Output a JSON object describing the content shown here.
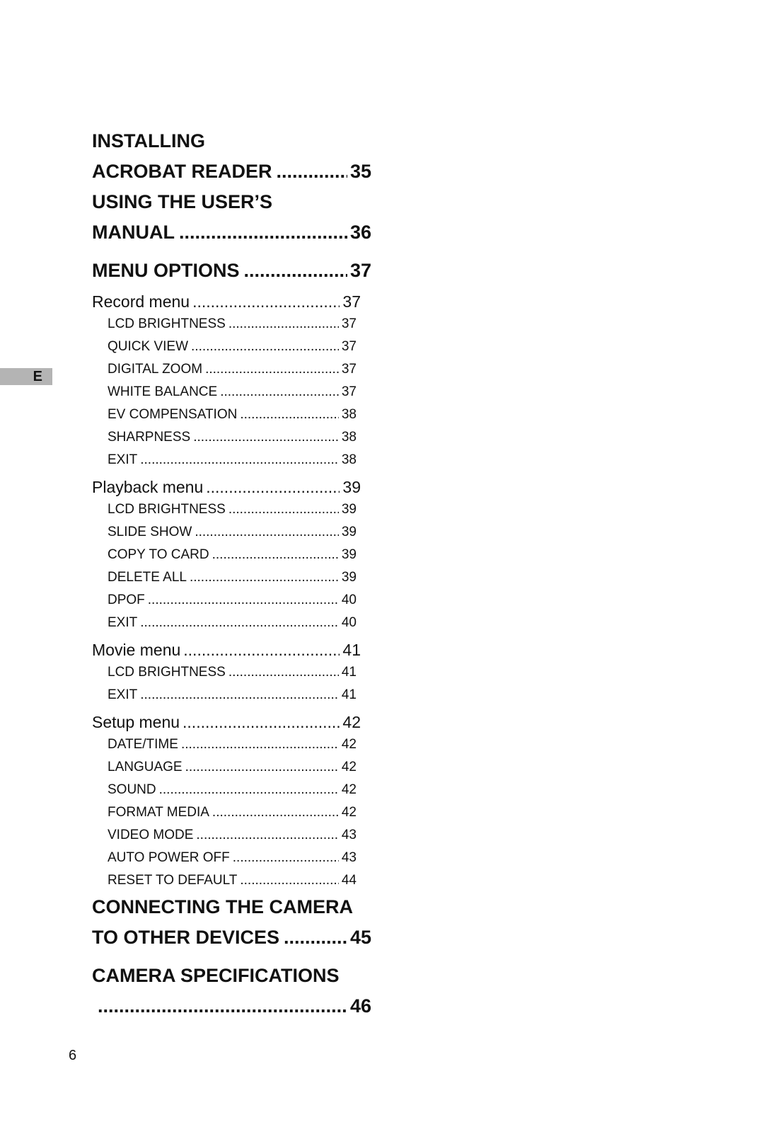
{
  "side_tab": {
    "label": "E",
    "color": "#b4b4b4"
  },
  "page_number": "6",
  "toc": [
    {
      "level": 1,
      "text": "INSTALLING",
      "page": ""
    },
    {
      "level": 1,
      "text": "ACROBAT READER",
      "page": "35"
    },
    {
      "level": 1,
      "text": "USING THE USER’S",
      "page": ""
    },
    {
      "level": 1,
      "text": "MANUAL",
      "page": "36"
    },
    {
      "level": 1,
      "text": "MENU OPTIONS",
      "page": "37"
    },
    {
      "level": 2,
      "text": "Record menu",
      "page": "37"
    },
    {
      "level": 3,
      "text": "LCD BRIGHTNESS",
      "page": "37"
    },
    {
      "level": 3,
      "text": "QUICK VIEW",
      "page": "37"
    },
    {
      "level": 3,
      "text": "DIGITAL ZOOM",
      "page": "37"
    },
    {
      "level": 3,
      "text": "WHITE BALANCE",
      "page": "37"
    },
    {
      "level": 3,
      "text": "EV COMPENSATION",
      "page": "38"
    },
    {
      "level": 3,
      "text": "SHARPNESS",
      "page": "38"
    },
    {
      "level": 3,
      "text": "EXIT",
      "page": "38"
    },
    {
      "level": 2,
      "text": "Playback menu",
      "page": "39"
    },
    {
      "level": 3,
      "text": "LCD BRIGHTNESS",
      "page": "39"
    },
    {
      "level": 3,
      "text": "SLIDE SHOW",
      "page": "39"
    },
    {
      "level": 3,
      "text": "COPY TO CARD",
      "page": "39"
    },
    {
      "level": 3,
      "text": "DELETE ALL",
      "page": "39"
    },
    {
      "level": 3,
      "text": "DPOF",
      "page": "40"
    },
    {
      "level": 3,
      "text": "EXIT",
      "page": "40"
    },
    {
      "level": 2,
      "text": "Movie menu",
      "page": "41"
    },
    {
      "level": 3,
      "text": "LCD BRIGHTNESS",
      "page": "41"
    },
    {
      "level": 3,
      "text": "EXIT",
      "page": "41"
    },
    {
      "level": 2,
      "text": "Setup menu",
      "page": "42"
    },
    {
      "level": 3,
      "text": "DATE/TIME",
      "page": "42"
    },
    {
      "level": 3,
      "text": "LANGUAGE",
      "page": "42"
    },
    {
      "level": 3,
      "text": "SOUND",
      "page": "42"
    },
    {
      "level": 3,
      "text": "FORMAT MEDIA",
      "page": "42"
    },
    {
      "level": 3,
      "text": "VIDEO MODE",
      "page": "43"
    },
    {
      "level": 3,
      "text": "AUTO POWER OFF",
      "page": "43"
    },
    {
      "level": 3,
      "text": "RESET TO DEFAULT",
      "page": "44"
    },
    {
      "level": 1,
      "text": "CONNECTING THE CAMERA",
      "page": ""
    },
    {
      "level": 1,
      "text": "TO OTHER DEVICES",
      "page": "45"
    },
    {
      "level": 1,
      "text": "CAMERA SPECIFICATIONS",
      "page": ""
    },
    {
      "level": 1,
      "text": "",
      "page": "46"
    }
  ]
}
